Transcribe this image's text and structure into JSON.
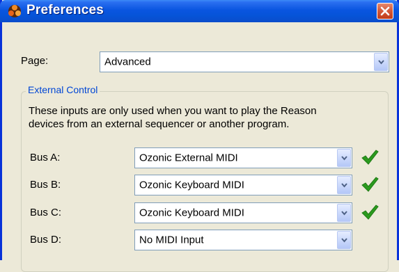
{
  "window": {
    "title": "Preferences"
  },
  "page_select": {
    "label": "Page:",
    "value": "Advanced"
  },
  "external_control": {
    "group_label": "External Control",
    "description_line1": "These inputs are only used when you want to play the Reason",
    "description_line2": "devices from an external sequencer or another program.",
    "buses": [
      {
        "label": "Bus A:",
        "value": "Ozonic External MIDI",
        "connected": true
      },
      {
        "label": "Bus B:",
        "value": "Ozonic Keyboard MIDI",
        "connected": true
      },
      {
        "label": "Bus C:",
        "value": "Ozonic Keyboard MIDI",
        "connected": true
      },
      {
        "label": "Bus D:",
        "value": "No MIDI Input",
        "connected": false
      }
    ]
  },
  "colors": {
    "titlebar": "#0a55e0",
    "group_label": "#0046d5",
    "check": "#2b9a1e"
  },
  "icons": {
    "app": "reason-logo-icon",
    "close": "close-icon",
    "dropdown": "chevron-down-icon",
    "status": "checkmark-icon"
  }
}
